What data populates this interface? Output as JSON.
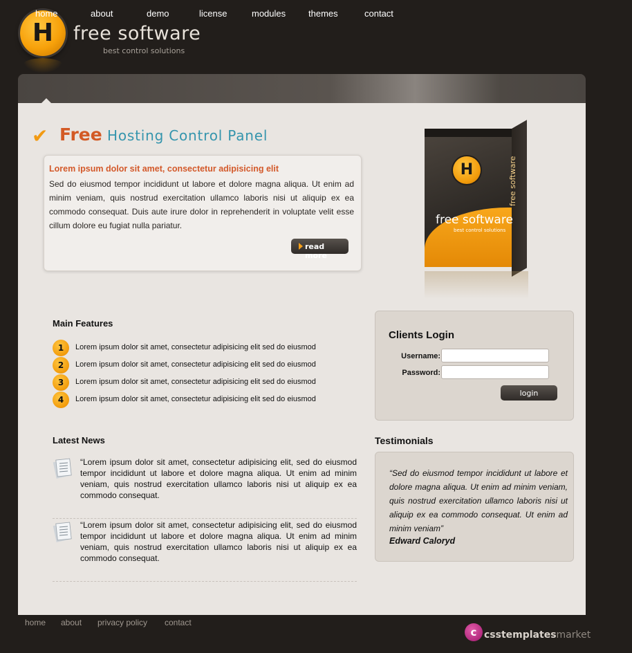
{
  "header": {
    "logo_letter": "H",
    "title": "free software",
    "tagline": "best control solutions"
  },
  "nav": {
    "items": [
      "home",
      "about",
      "demo",
      "license",
      "modules",
      "themes",
      "contact"
    ],
    "active": "home"
  },
  "hero": {
    "title_highlight": "Free",
    "title_rest": "Hosting Control Panel",
    "heading": "Lorem ipsum dolor sit amet, consectetur adipisicing elit",
    "text": "Sed do eiusmod tempor incididunt ut labore et dolore magna aliqua. Ut enim ad minim veniam, quis nostrud exercitation ullamco laboris nisi ut aliquip ex ea commodo consequat. Duis aute irure dolor in reprehenderit in voluptate velit esse cillum dolore eu fugiat nulla pariatur.",
    "read_more": "read more"
  },
  "product_box": {
    "logo_letter": "H",
    "name": "free software",
    "tagline": "best control solutions",
    "side_text": "free software"
  },
  "features": {
    "heading": "Main Features",
    "items": [
      {
        "num": "1",
        "text": "Lorem ipsum dolor sit amet, consectetur adipisicing elit sed do eiusmod"
      },
      {
        "num": "2",
        "text": "Lorem ipsum dolor sit amet, consectetur adipisicing elit sed do eiusmod"
      },
      {
        "num": "3",
        "text": "Lorem ipsum dolor sit amet, consectetur adipisicing elit sed do eiusmod"
      },
      {
        "num": "4",
        "text": "Lorem ipsum dolor sit amet, consectetur adipisicing elit sed do eiusmod"
      }
    ]
  },
  "login": {
    "heading": "Clients Login",
    "username_label": "Username:",
    "password_label": "Password:",
    "username_value": "",
    "password_value": "",
    "button": "login"
  },
  "news": {
    "heading": "Latest News",
    "items": [
      {
        "text": "“Lorem ipsum dolor sit amet, consectetur adipisicing elit, sed do eiusmod tempor incididunt ut labore et dolore magna aliqua. Ut enim ad minim veniam, quis nostrud exercitation ullamco laboris nisi ut aliquip ex ea commodo consequat."
      },
      {
        "text": "“Lorem ipsum dolor sit amet, consectetur adipisicing elit, sed do eiusmod tempor incididunt ut labore et dolore magna aliqua. Ut enim ad minim veniam, quis nostrud exercitation ullamco laboris nisi ut aliquip ex ea commodo consequat."
      }
    ]
  },
  "testimonials": {
    "heading": "Testimonials",
    "quote": "“Sed do eiusmod tempor incididunt ut labore et dolore magna aliqua. Ut enim ad minim veniam, quis nostrud exercitation ullamco laboris nisi ut aliquip ex ea commodo consequat. Ut enim ad minim veniam”",
    "author": "Edward Caloryd"
  },
  "footer": {
    "links": [
      "home",
      "about",
      "privacy policy",
      "contact"
    ],
    "badge_letter": "c",
    "badge_bold": "csstemplates",
    "badge_light": "market"
  },
  "colors": {
    "background": "#221e1b",
    "panel": "#e9e5e1",
    "accent_orange": "#f29b0b",
    "title_red": "#d35a25",
    "title_blue": "#3595ad"
  }
}
